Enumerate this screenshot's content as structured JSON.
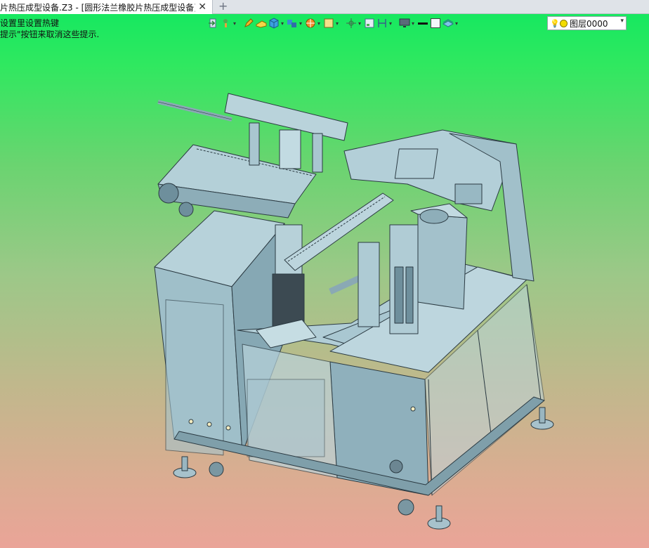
{
  "tab": {
    "title": "片热压成型设备.Z3 - [圆形法兰橡胶片热压成型设备]",
    "close_glyph": "✕",
    "new_glyph": "+"
  },
  "hints": [
    "设置里设置热键",
    "提示\"按钮来取消这些提示."
  ],
  "layer": {
    "name": "图层0000",
    "bulb": "💡",
    "arrow": "▾"
  },
  "colors": {
    "metal": "#a8c6d0",
    "metal_dark": "#6e8f9c",
    "edge": "#2b3a42",
    "bg_top": "#10e860",
    "bg_bottom": "#eaa498"
  },
  "toolbar": [
    "exit-icon",
    "brush-icon",
    "pencil-icon",
    "cheese-icon",
    "cube-icon",
    "cubes-icon",
    "pie-icon",
    "square-icon",
    "crosshair-icon",
    "frame-icon",
    "align-icon",
    "monitor-icon",
    "line-icon",
    "box-icon",
    "layers-icon"
  ]
}
